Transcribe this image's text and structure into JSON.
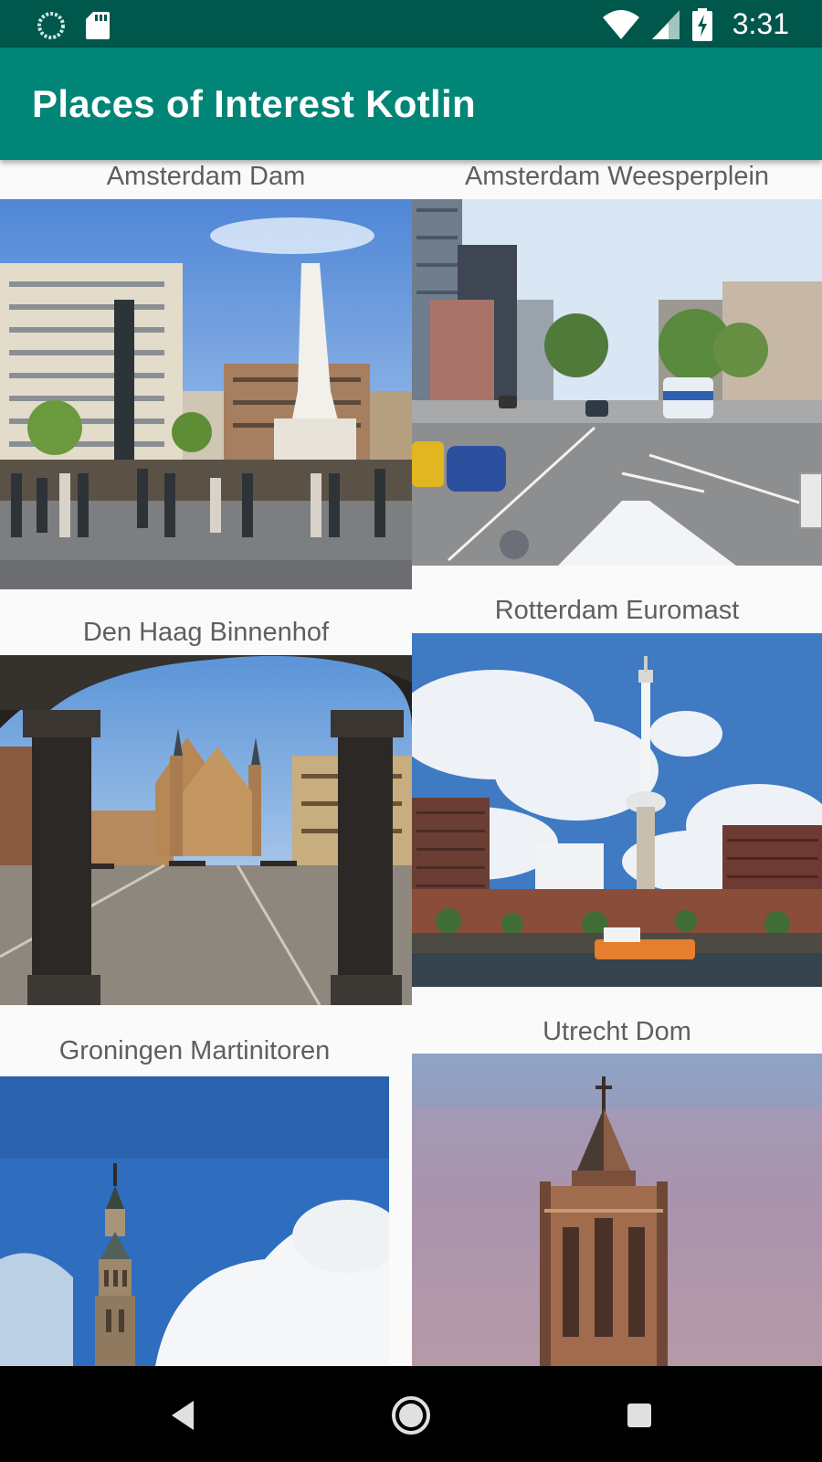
{
  "status_bar": {
    "time": "3:31",
    "icons": [
      "loading-circle-icon",
      "sd-card-icon",
      "wifi-icon",
      "signal-icon",
      "battery-charging-icon"
    ]
  },
  "app_bar": {
    "title": "Places of Interest Kotlin"
  },
  "places": [
    {
      "title": "Amsterdam Dam"
    },
    {
      "title": "Amsterdam Weesperplein"
    },
    {
      "title": "Den Haag Binnenhof"
    },
    {
      "title": "Rotterdam Euromast"
    },
    {
      "title": "Groningen Martinitoren"
    },
    {
      "title": "Utrecht Dom"
    }
  ],
  "nav_bar": {
    "icons": [
      "back-icon",
      "home-icon",
      "recents-icon"
    ]
  },
  "colors": {
    "status_bar": "#00574b",
    "app_bar": "#008577",
    "background": "#fafafa",
    "title_text": "#5f5f5f"
  }
}
